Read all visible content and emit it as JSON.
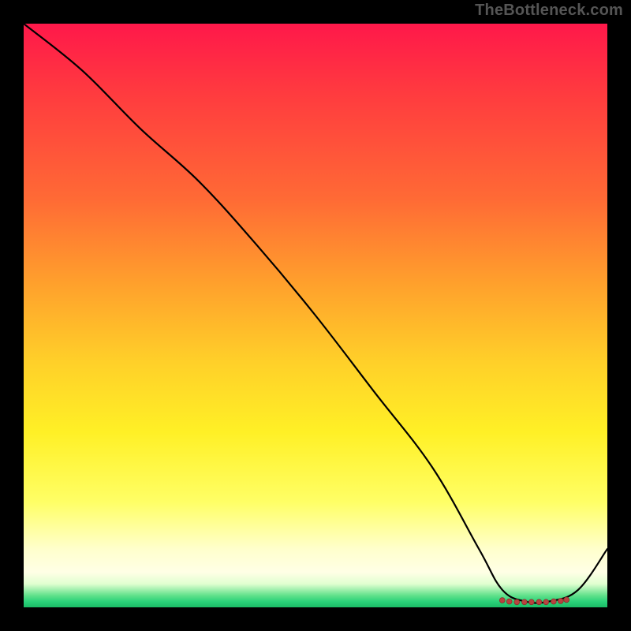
{
  "watermark": "TheBottleneck.com",
  "colors": {
    "curve": "#000000",
    "dot_fill": "#b8433f",
    "dot_stroke": "#8a2f2c"
  },
  "chart_data": {
    "type": "line",
    "title": "",
    "xlabel": "",
    "ylabel": "",
    "xlim": [
      0,
      100
    ],
    "ylim": [
      0,
      100
    ],
    "grid": false,
    "series": [
      {
        "name": "bottleneck-curve",
        "x": [
          0,
          10,
          20,
          30,
          40,
          50,
          60,
          70,
          78,
          82,
          86,
          90,
          95,
          100
        ],
        "y": [
          100,
          92,
          82,
          73,
          62,
          50,
          37,
          24,
          10,
          3,
          1,
          1,
          3,
          10
        ]
      }
    ],
    "highlight_points": {
      "name": "optimal-region",
      "x": [
        82,
        83.2,
        84.5,
        85.8,
        87,
        88.3,
        89.5,
        90.8,
        92,
        93
      ],
      "y": [
        1.2,
        1.0,
        0.9,
        0.9,
        0.9,
        0.9,
        0.9,
        1.0,
        1.1,
        1.3
      ]
    },
    "background_gradient": {
      "top": "#ff184a",
      "upper_mid": "#ffa22c",
      "mid": "#fff026",
      "lower_mid": "#ffffcc",
      "bottom": "#1abc66"
    }
  }
}
